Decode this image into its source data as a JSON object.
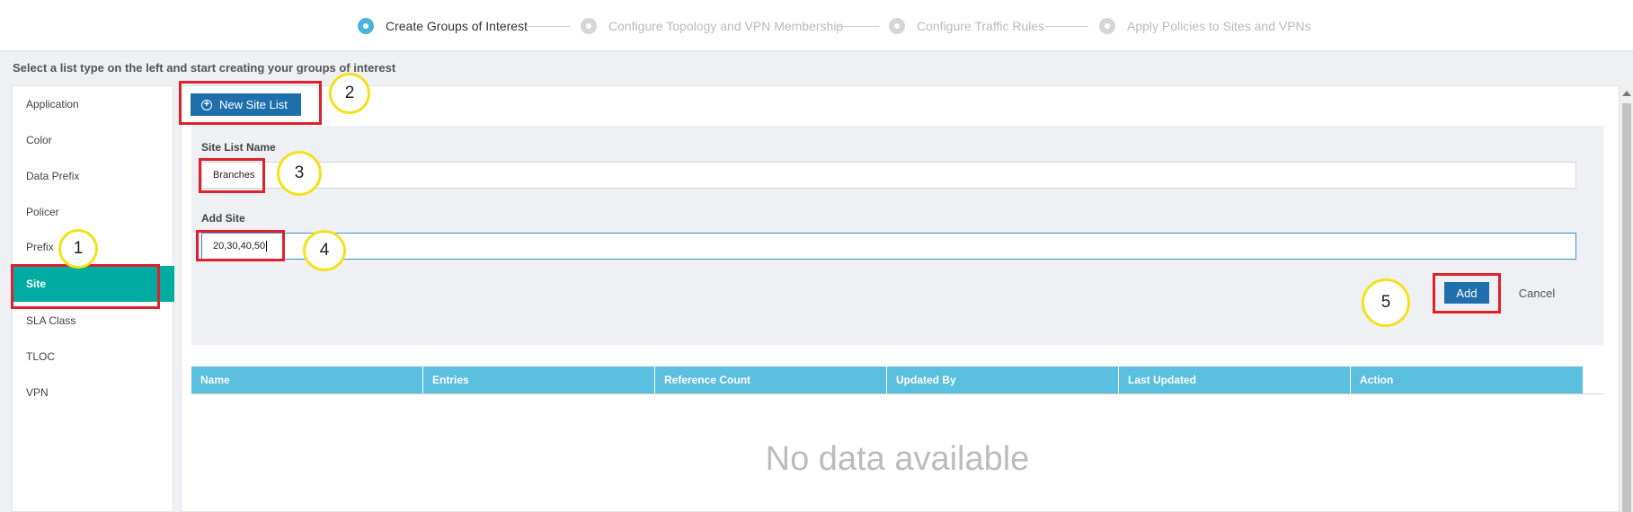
{
  "wizard": {
    "steps": [
      {
        "label": "Create Groups of Interest",
        "state": "active"
      },
      {
        "label": "Configure Topology and VPN Membership",
        "state": "inactive"
      },
      {
        "label": "Configure Traffic Rules",
        "state": "inactive"
      },
      {
        "label": "Apply Policies to Sites and VPNs",
        "state": "inactive"
      }
    ]
  },
  "instruction": "Select a list type on the left and start creating your groups of interest",
  "sidebar": {
    "items": [
      {
        "label": "Application"
      },
      {
        "label": "Color"
      },
      {
        "label": "Data Prefix"
      },
      {
        "label": "Policer"
      },
      {
        "label": "Prefix"
      },
      {
        "label": "Site",
        "active": true
      },
      {
        "label": "SLA Class"
      },
      {
        "label": "TLOC"
      },
      {
        "label": "VPN"
      }
    ]
  },
  "toolbar": {
    "new_site_list_label": "New Site List"
  },
  "form": {
    "site_list_name_label": "Site List Name",
    "site_list_name_value": "Branches",
    "add_site_label": "Add Site",
    "add_site_value": "20,30,40,50",
    "add_button_label": "Add",
    "cancel_button_label": "Cancel"
  },
  "table": {
    "columns": [
      "Name",
      "Entries",
      "Reference Count",
      "Updated By",
      "Last Updated",
      "Action"
    ],
    "empty_text": "No data available"
  },
  "annotations": {
    "callouts": [
      "1",
      "2",
      "3",
      "4",
      "5"
    ]
  },
  "colors": {
    "accent": "#4bb3dc",
    "active_item": "#00aba2",
    "primary_button": "#1f6fad",
    "table_header": "#5bbfdf",
    "annotation_box": "#e0202a",
    "annotation_circle": "#f3e21a"
  }
}
